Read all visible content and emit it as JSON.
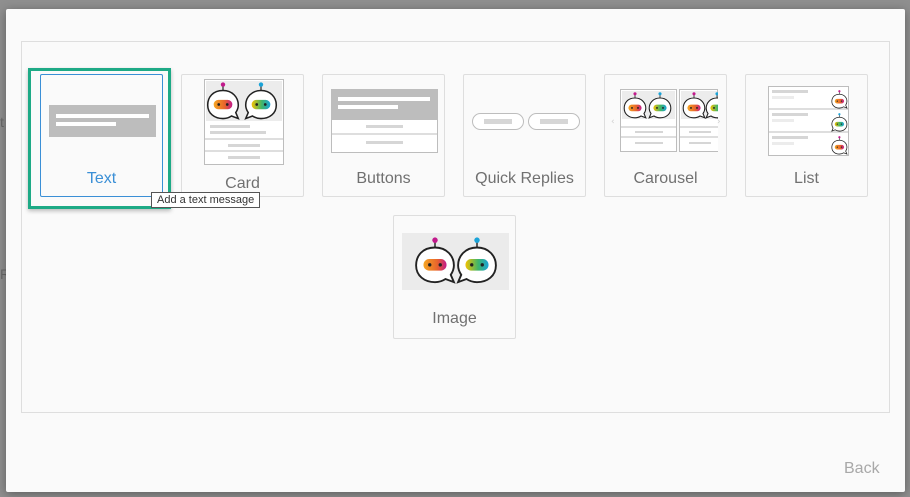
{
  "background": {
    "peek_a": "t",
    "peek_b": "R"
  },
  "options": [
    {
      "id": "text",
      "label": "Text",
      "icon": "text-message-icon",
      "selected": true
    },
    {
      "id": "card",
      "label": "Card",
      "icon": "card-icon"
    },
    {
      "id": "buttons",
      "label": "Buttons",
      "icon": "buttons-icon"
    },
    {
      "id": "quick_replies",
      "label": "Quick Replies",
      "icon": "quick-replies-icon"
    },
    {
      "id": "carousel",
      "label": "Carousel",
      "icon": "carousel-icon"
    },
    {
      "id": "list",
      "label": "List",
      "icon": "list-icon"
    },
    {
      "id": "image",
      "label": "Image",
      "icon": "image-icon"
    }
  ],
  "tooltip": {
    "text": "Add a text message"
  },
  "footer": {
    "back_label": "Back"
  },
  "colors": {
    "accent": "#3a8fd6",
    "focus_ring": "#1eaa86",
    "placeholder_gray": "#bdbdbd",
    "bot_magenta": "#c21a8c",
    "bot_orange": "#f5a623",
    "bot_yellow": "#f2c200",
    "bot_cyan": "#1aa3d8"
  }
}
